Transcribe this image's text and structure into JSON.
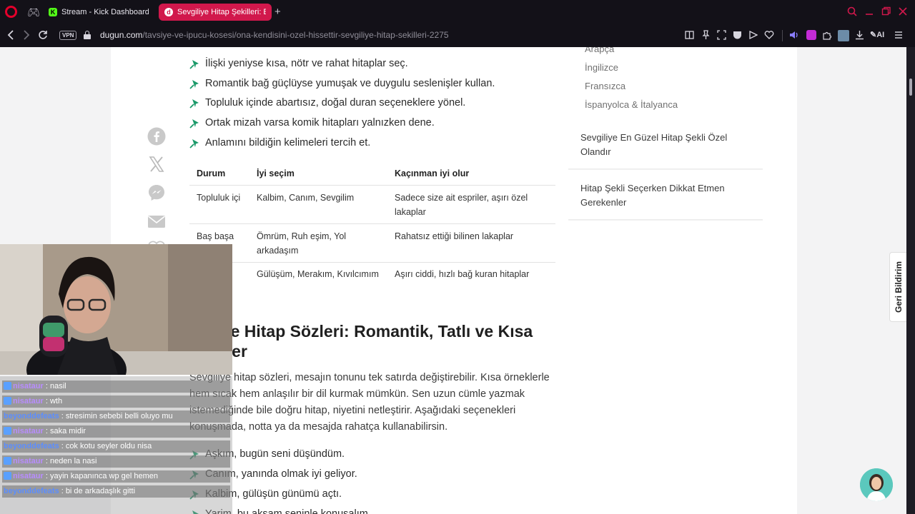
{
  "browser": {
    "tabs": [
      {
        "label": "Stream - Kick Dashboard",
        "favicon": "K",
        "active": false
      },
      {
        "label": "Sevgiliye Hitap Şekilleri: Erk",
        "favicon": "d",
        "active": true
      }
    ],
    "new_tab_symbol": "+",
    "vpn_badge": "VPN",
    "url_host": "dugun.com",
    "url_path": "/tavsiye-ve-ipucu-kosesi/ona-kendisini-ozel-hissettir-sevgiliye-hitap-sekilleri-2275",
    "ai_label": "AI",
    "accent_color": "#d1184c"
  },
  "article": {
    "tips": [
      "İlişki yeniyse kısa, nötr ve rahat hitaplar seç.",
      "Romantik bağ güçlüyse yumuşak ve duygulu seslenişler kullan.",
      "Topluluk içinde abartısız, doğal duran seçeneklere yönel.",
      "Ortak mizah varsa komik hitapları yalnızken dene.",
      "Anlamını bildiğin kelimeleri tercih et."
    ],
    "table": {
      "headers": [
        "Durum",
        "İyi seçim",
        "Kaçınman iyi olur"
      ],
      "rows": [
        [
          "Topluluk içi",
          "Kalbim, Canım, Sevgilim",
          "Sadece size ait espriler, aşırı özel lakaplar"
        ],
        [
          "Baş başa",
          "Ömrüm, Ruh eşim, Yol arkadaşım",
          "Rahatsız ettiği bilinen lakaplar"
        ],
        [
          "",
          "Gülüşüm, Merakım, Kıvılcımım",
          "Aşırı ciddi, hızlı bağ kuran hitaplar"
        ]
      ]
    },
    "heading": "liye Hitap Sözleri: Romantik, Tatlı ve Kısa klerler",
    "heading_line1": "liye Hitap Sözleri: Romantik, Tatlı ve Kısa",
    "heading_line2": "kler",
    "paragraph": "Sevgiliye hitap sözleri, mesajın tonunu tek satırda değiştirebilir. Kısa örneklerle hem sıcak hem anlaşılır bir dil kurmak mümkün. Sen uzun cümle yazmak istemediğinde bile doğru hitap, niyetini netleştirir. Aşağıdaki seçenekleri konuşmada, notta ya da mesajda rahatça kullanabilirsin.",
    "examples": [
      "Aşkım, bugün seni düşündüm.",
      "Canım, yanında olmak iyi geliyor.",
      "Kalbim, gülüşün günümü açtı.",
      "Yarim, bu akşam seninle konuşalım."
    ]
  },
  "sidebar": {
    "languages": [
      "Arapça",
      "İngilizce",
      "Fransızca",
      "İspanyolca & İtalyanca"
    ],
    "links": [
      "Sevgiliye En Güzel Hitap Şekli Özel Olandır",
      "Hitap Şekli Seçerken Dikkat Etmen Gerekenler"
    ]
  },
  "feedback_label": "Geri Bildirim",
  "chat": [
    {
      "user": "nisataur",
      "message": ": nasil",
      "color": "#b88cff"
    },
    {
      "user": "nisataur",
      "message": ": wth",
      "color": "#b88cff"
    },
    {
      "user": "beyonddefeats",
      "message": ": stresimin sebebi belli oluyo mu",
      "color": "#5b8dff"
    },
    {
      "user": "nisataur",
      "message": ": saka midir",
      "color": "#b88cff"
    },
    {
      "user": "beyonddefeats",
      "message": ": cok kotu seyler oldu nisa",
      "color": "#5b8dff"
    },
    {
      "user": "nisataur",
      "message": ": neden la nasi",
      "color": "#b88cff"
    },
    {
      "user": "nisataur",
      "message": ": yayin kapanınca wp gel hemen",
      "color": "#b88cff"
    },
    {
      "user": "beyonddefeats",
      "message": ": bi de arkadaşlık gitti",
      "color": "#5b8dff"
    }
  ]
}
